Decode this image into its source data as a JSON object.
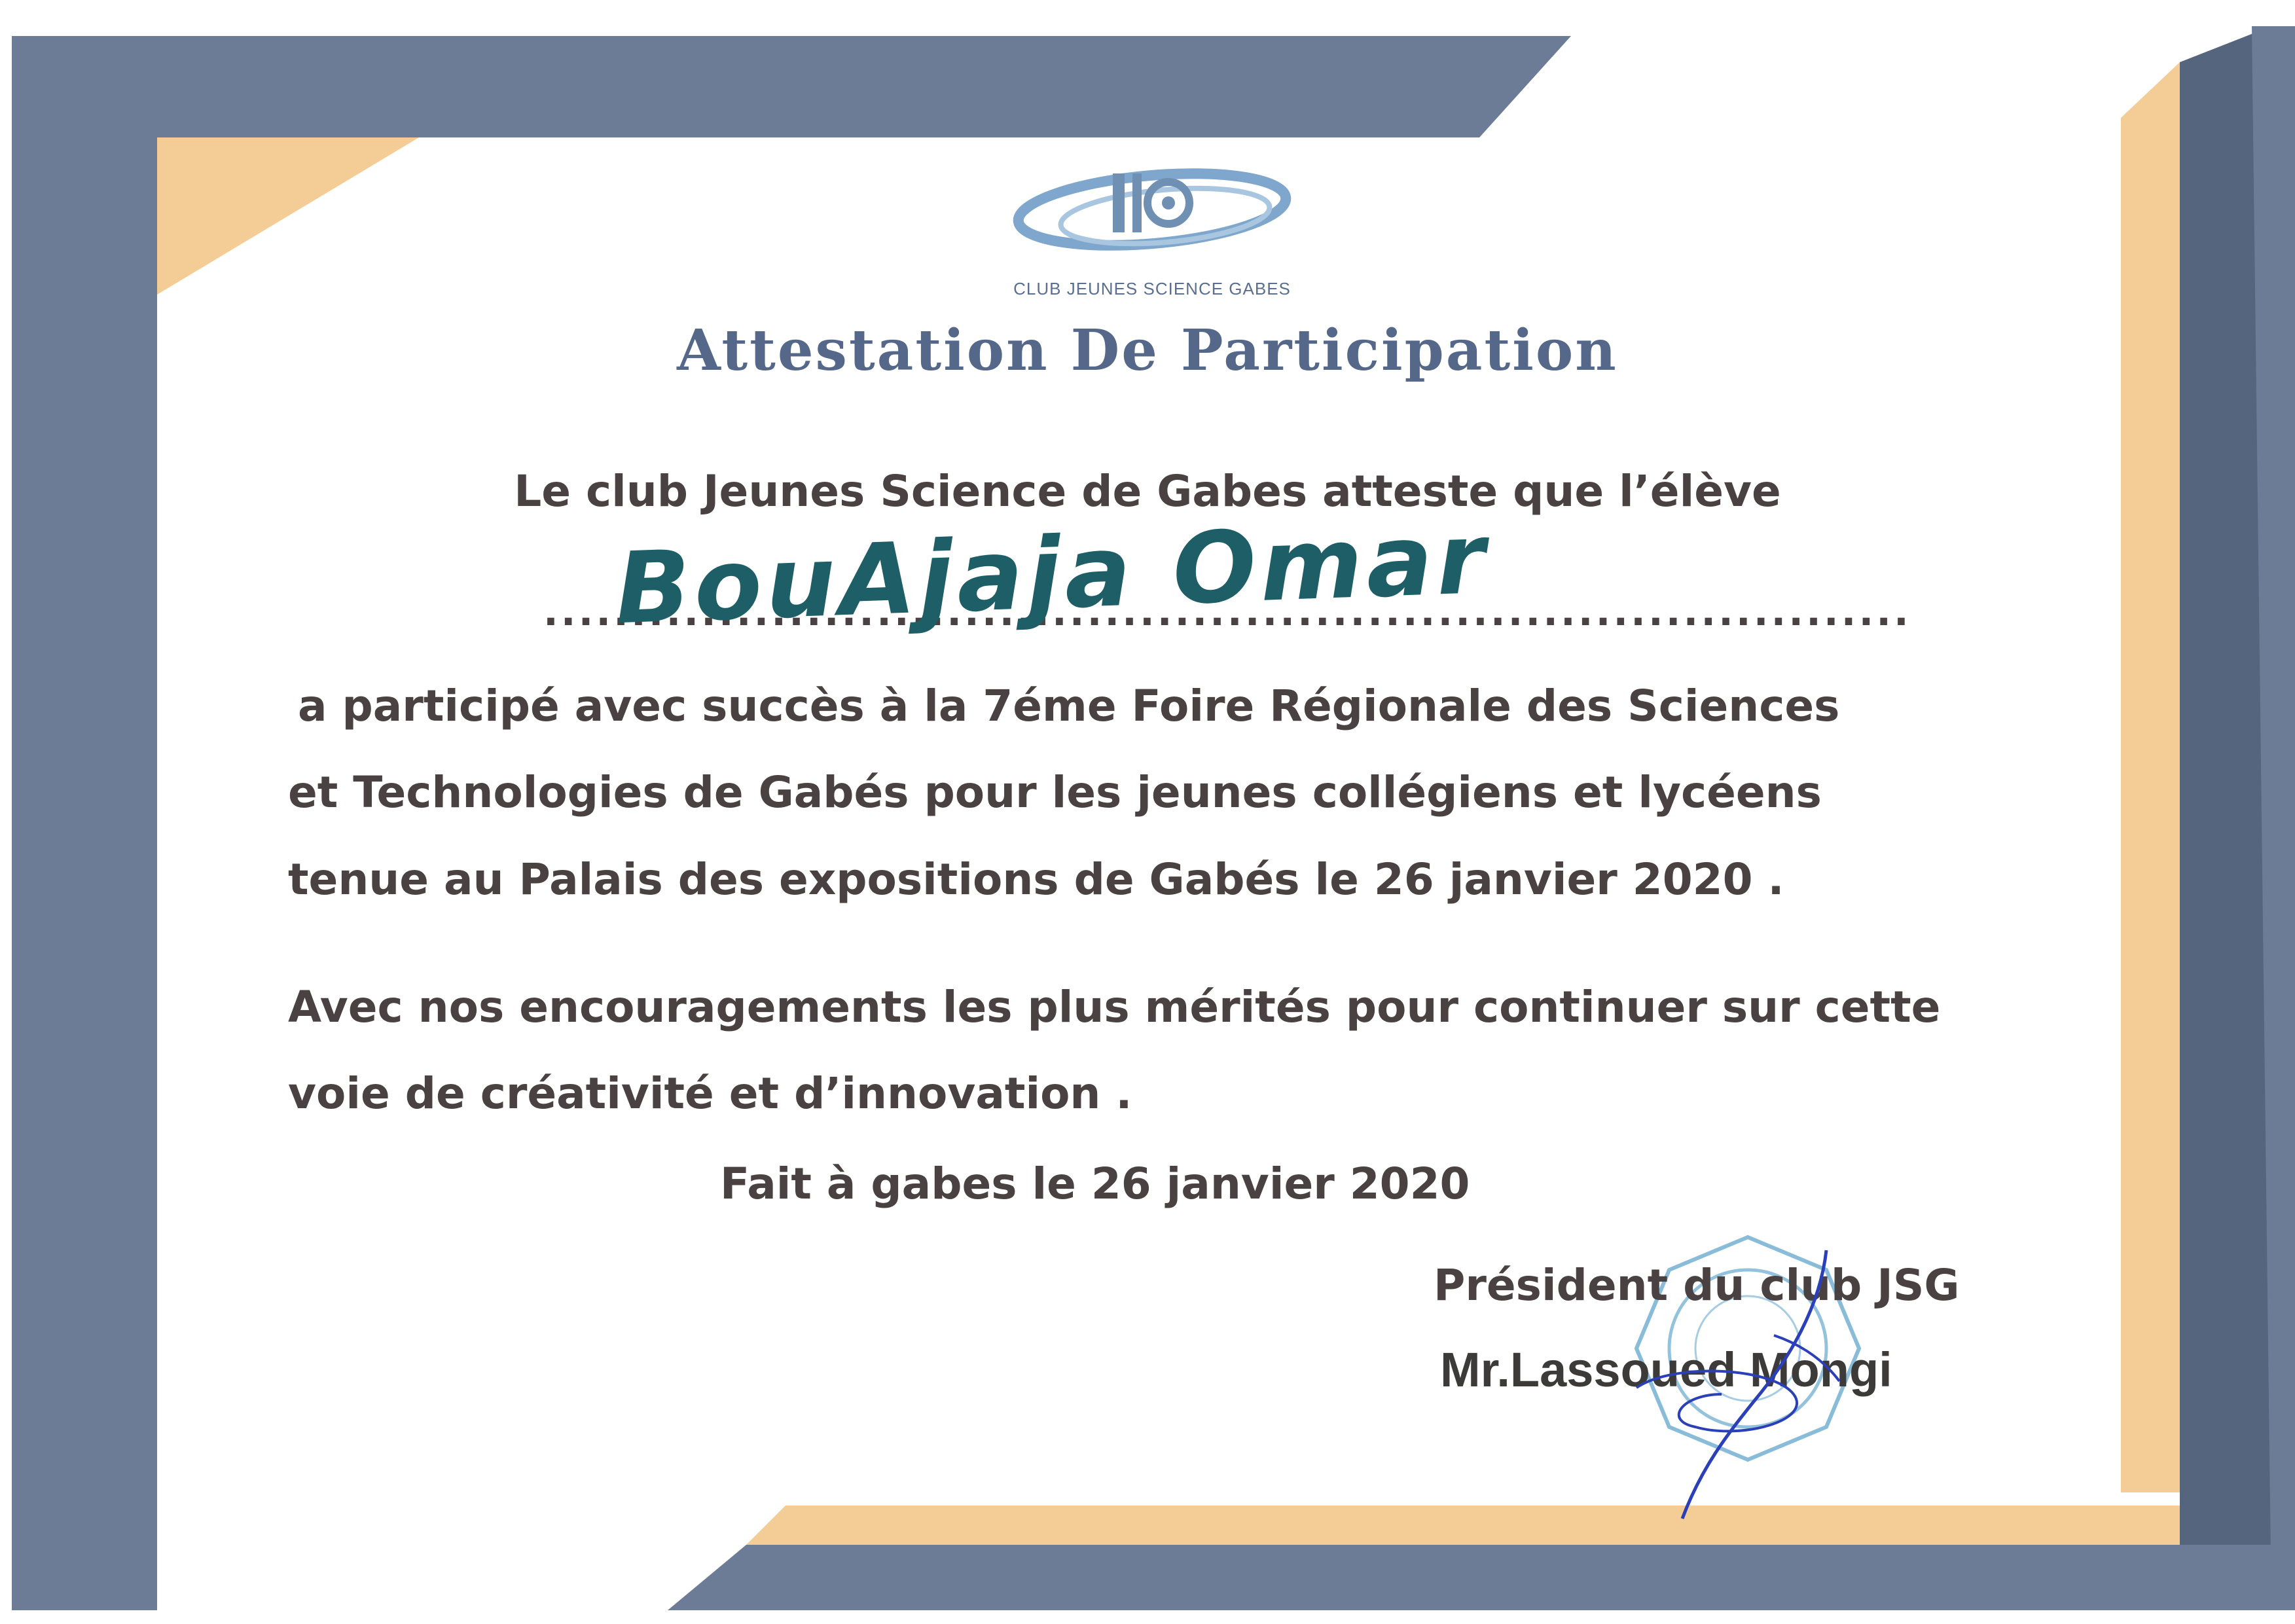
{
  "logo": {
    "text": "CLUB JEUNES SCIENCE GABES",
    "monogram": "JSG",
    "icon": "jsg-logo-icon"
  },
  "title": "Attestation De Participation",
  "intro": "Le club Jeunes Science de Gabes atteste que l’élève",
  "name_dots": "..............................................................................",
  "student_name": "BouAjaja Omar",
  "body_lines": [
    "a participé avec succès à la 7éme Foire Régionale des Sciences",
    "et  Technologies de Gabés pour les jeunes collégiens et lycéens",
    "tenue  au Palais des expositions de Gabés le 26 janvier 2020 ."
  ],
  "encouragement_lines": [
    "Avec nos encouragements les plus mérités pour continuer sur cette",
    "voie de créativité et d’innovation ."
  ],
  "date_line": "Fait à gabes le 26 janvier 2020",
  "president_title": "Président du club JSG",
  "president_name": "Mr.Lassoued Mongi",
  "colors": {
    "frame_blue": "#6c7c97",
    "frame_dark": "#56657e",
    "frame_peach": "#f3cc96",
    "title": "#56688a",
    "ink": "#1e5e66",
    "signature": "#2a3fb8",
    "stamp": "#3a8fc0"
  }
}
